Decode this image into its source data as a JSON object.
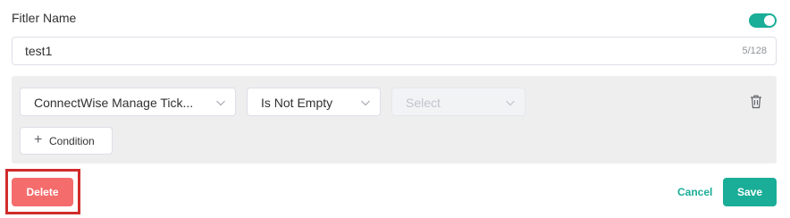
{
  "filter": {
    "label": "Fitler Name",
    "enabled": true,
    "name_value": "test1",
    "char_count": "5/128"
  },
  "condition": {
    "field": "ConnectWise Manage Tick...",
    "operator": "Is Not Empty",
    "value_placeholder": "Select",
    "delete_icon": "trash-icon",
    "arrow_icon": "chevron-down-icon"
  },
  "add_condition": {
    "label": "Condition",
    "icon": "plus-icon"
  },
  "footer": {
    "delete_label": "Delete",
    "cancel_label": "Cancel",
    "save_label": "Save"
  },
  "colors": {
    "accent": "#1aad97",
    "danger": "#f56c6c",
    "highlight": "#d12b2b",
    "panel": "#eeeeef"
  }
}
